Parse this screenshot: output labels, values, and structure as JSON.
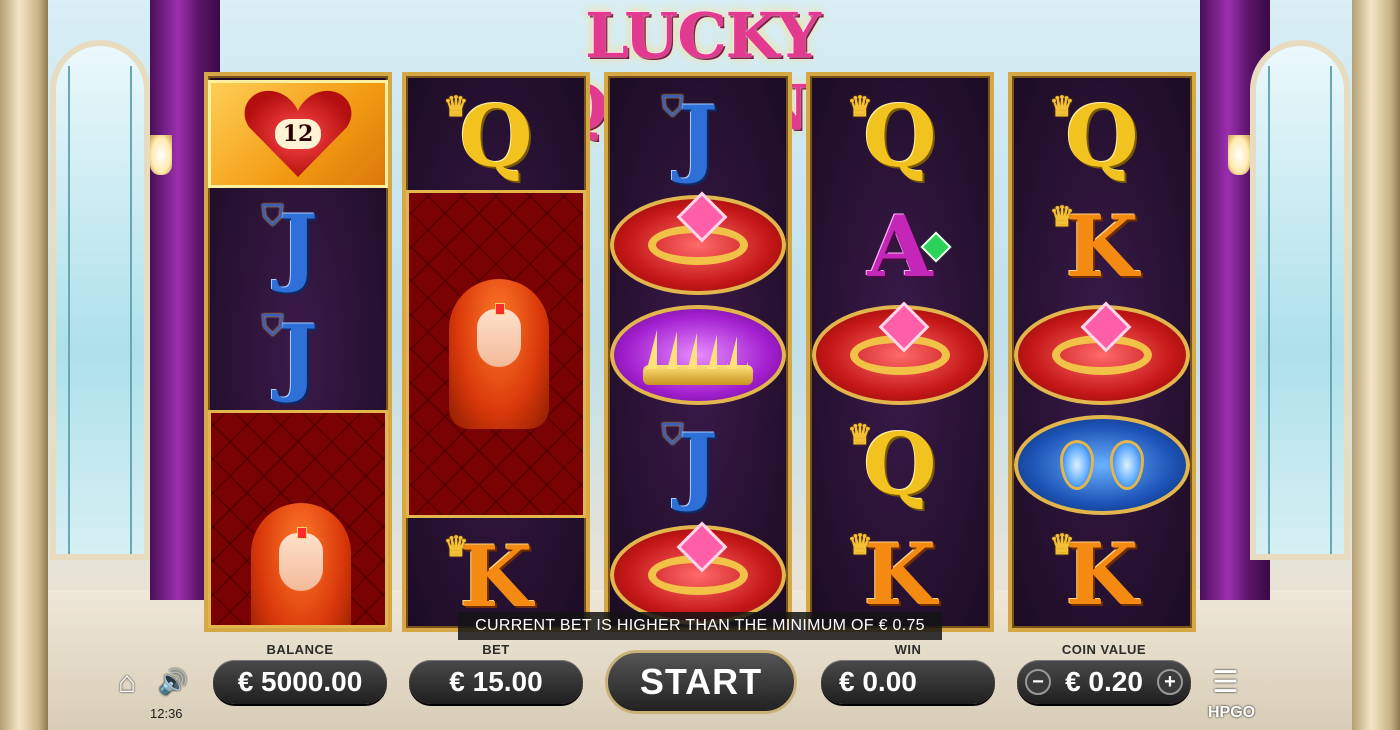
{
  "logo": {
    "title": "LUCKY QUEENS"
  },
  "reels": [
    {
      "symbols": [
        "heart-12",
        "J",
        "J",
        "queen"
      ],
      "heart_value": "12"
    },
    {
      "symbols": [
        "Q",
        "queen",
        "K"
      ]
    },
    {
      "symbols": [
        "J",
        "ring",
        "crown",
        "J",
        "ring"
      ]
    },
    {
      "symbols": [
        "Q",
        "A",
        "ring",
        "Q",
        "K"
      ]
    },
    {
      "symbols": [
        "Q",
        "K",
        "ring",
        "earrings",
        "K"
      ]
    }
  ],
  "notice": "CURRENT BET IS HIGHER THAN THE MINIMUM OF € 0.75",
  "labels": {
    "balance": "BALANCE",
    "bet": "BET",
    "win": "WIN",
    "coin_value": "COIN VALUE"
  },
  "values": {
    "balance": "€ 5000.00",
    "bet": "€ 15.00",
    "win": "€ 0.00",
    "coin_value": "€ 0.20"
  },
  "start_label": "START",
  "clock": "12:36",
  "brand": "HPGO",
  "letters": {
    "J": "J",
    "Q": "Q",
    "K": "K",
    "A": "A"
  },
  "controls": {
    "minus": "−",
    "plus": "+",
    "home": "⌂",
    "sound": "🔊",
    "menu": "☰"
  },
  "colors": {
    "reel_frame": "#d6a845",
    "reel_bg": "#24102e",
    "logo": "#e23a8f",
    "button": "#2a2a2a"
  }
}
